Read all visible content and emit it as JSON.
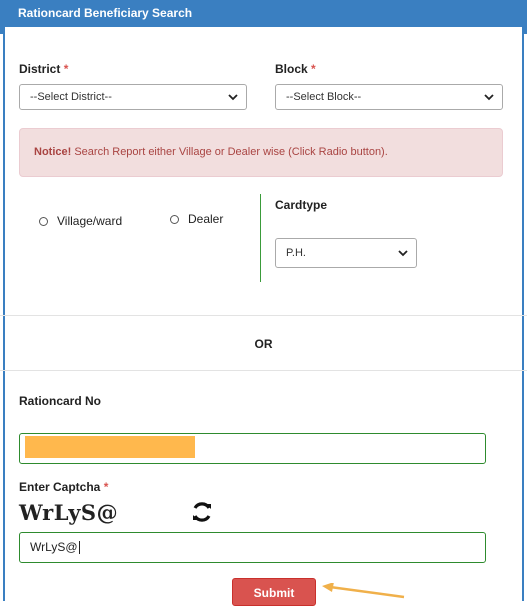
{
  "header": {
    "title": "Rationcard Beneficiary Search"
  },
  "district": {
    "label": "District",
    "required": "*",
    "selected": "--Select District--"
  },
  "block": {
    "label": "Block",
    "required": "*",
    "selected": "--Select Block--"
  },
  "notice": {
    "bold": "Notice!",
    "text": " Search Report either Village or Dealer wise (Click Radio button)."
  },
  "radios": {
    "village": "Village/ward",
    "dealer": "Dealer"
  },
  "cardtype": {
    "label": "Cardtype",
    "selected": "P.H."
  },
  "separator": {
    "text": "OR"
  },
  "rationcard": {
    "label": "Rationcard No",
    "value": ""
  },
  "captcha": {
    "label": "Enter Captcha",
    "required": "*",
    "image_text": "WrLyS@",
    "value": "WrLyS@"
  },
  "submit": {
    "label": "Submit"
  },
  "colors": {
    "header": "#3a7fc1",
    "alert_bg": "#f2dede",
    "alert_text": "#a94442",
    "submit": "#d9534f",
    "input_border": "#2e8b2e",
    "arrow": "#f0b04a"
  }
}
